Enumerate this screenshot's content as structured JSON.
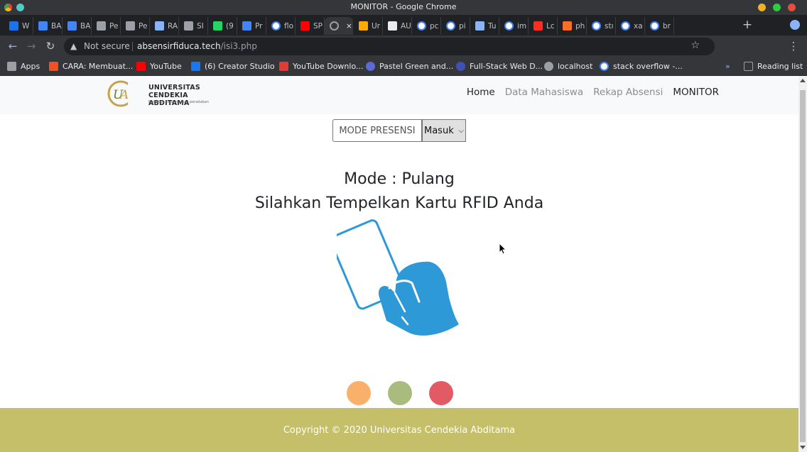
{
  "window": {
    "title": "MONITOR - Google Chrome"
  },
  "tabs": [
    {
      "label": "W",
      "icon": "dropbox-icon",
      "color": "#1a73e8"
    },
    {
      "label": "BA",
      "icon": "docs-icon",
      "color": "#4285f4"
    },
    {
      "label": "BA",
      "icon": "docs-icon",
      "color": "#4285f4"
    },
    {
      "label": "Pe",
      "icon": "globe-icon",
      "color": "#9aa0a6"
    },
    {
      "label": "Pe",
      "icon": "globe-icon",
      "color": "#9aa0a6"
    },
    {
      "label": "RA",
      "icon": "file-icon",
      "color": "#8ab4f8"
    },
    {
      "label": "SI",
      "icon": "globe-icon",
      "color": "#9aa0a6"
    },
    {
      "label": "(9",
      "icon": "whatsapp-icon",
      "color": "#25d366"
    },
    {
      "label": "Pr",
      "icon": "globe-icon",
      "color": "#4285f4"
    },
    {
      "label": "flo",
      "icon": "google-icon",
      "color": "#ffffff"
    },
    {
      "label": "SP",
      "icon": "youtube-icon",
      "color": "#ff0000"
    },
    {
      "label": "",
      "icon": "loading-icon",
      "color": "#9aa0a6",
      "active": true
    },
    {
      "label": "Ur",
      "icon": "puzzle-icon",
      "color": "#f9ab00"
    },
    {
      "label": "AU",
      "icon": "tv-icon",
      "color": "#e8eaed"
    },
    {
      "label": "pc",
      "icon": "google-icon",
      "color": "#ffffff"
    },
    {
      "label": "pi",
      "icon": "google-icon",
      "color": "#ffffff"
    },
    {
      "label": "Tu",
      "icon": "globe-icon",
      "color": "#8ab4f8"
    },
    {
      "label": "im",
      "icon": "google-icon",
      "color": "#ffffff"
    },
    {
      "label": "Lc",
      "icon": "laravel-icon",
      "color": "#ff2d20"
    },
    {
      "label": "ph",
      "icon": "gitlab-icon",
      "color": "#fc6d26"
    },
    {
      "label": "stı",
      "icon": "google-icon",
      "color": "#ffffff"
    },
    {
      "label": "xa",
      "icon": "google-icon",
      "color": "#ffffff"
    },
    {
      "label": "br",
      "icon": "google-icon",
      "color": "#ffffff"
    }
  ],
  "address": {
    "security": "Not secure",
    "host": "absensirfiduca.tech",
    "path": "/isi3.php"
  },
  "bookmarks": [
    {
      "label": "Apps",
      "icon": "apps-grid-icon",
      "color": "#9aa0a6"
    },
    {
      "label": "CARA: Membuat...",
      "icon": "microsoft-icon",
      "color": "#f25022"
    },
    {
      "label": "YouTube",
      "icon": "youtube-icon",
      "color": "#ff0000"
    },
    {
      "label": "(6) Creator Studio",
      "icon": "creator-studio-icon",
      "color": "#1877f2"
    },
    {
      "label": "YouTube Downlo...",
      "icon": "download-icon",
      "color": "#e53935"
    },
    {
      "label": "Pastel Green and...",
      "icon": "canva-icon",
      "color": "#5b6bd5"
    },
    {
      "label": "Full-Stack Web D...",
      "icon": "wave-icon",
      "color": "#3f51b5"
    },
    {
      "label": "localhost",
      "icon": "globe-icon",
      "color": "#9aa0a6"
    },
    {
      "label": "stack overflow -...",
      "icon": "google-icon",
      "color": "#ffffff"
    }
  ],
  "reading_list": "Reading list",
  "site": {
    "logo_line1": "UNIVERSITAS",
    "logo_line2": "CENDEKIA ABDITAMA",
    "logo_tagline": "Menabur ilmu, menuai peradaban",
    "nav": [
      {
        "label": "Home",
        "state": "active"
      },
      {
        "label": "Data Mahasiswa",
        "state": "muted"
      },
      {
        "label": "Rekap Absensi",
        "state": "muted"
      },
      {
        "label": "MONITOR",
        "state": "active"
      }
    ],
    "mode_label": "MODE PRESENSI",
    "mode_value": "Masuk",
    "mode_heading": "Mode : Pulang",
    "instruction": "Silahkan Tempelkan Kartu RFID Anda",
    "status_dots": [
      "#f9b06a",
      "#a9bb7d",
      "#e25a63"
    ],
    "footer": "Copyright © 2020 Universitas Cendekia Abditama",
    "accent": "#2d99d6",
    "footer_color": "#c5bf69"
  }
}
